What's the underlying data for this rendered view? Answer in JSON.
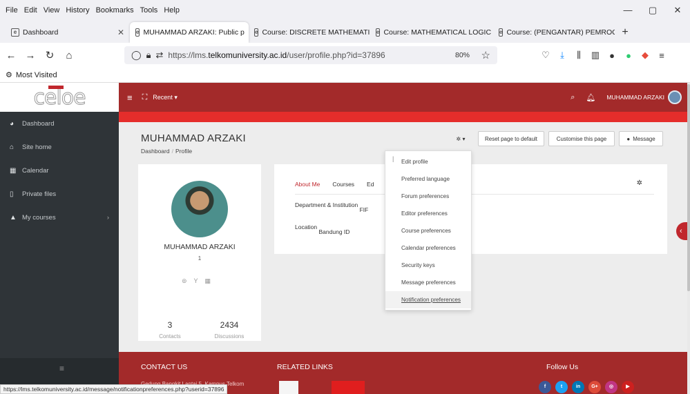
{
  "browser": {
    "menu": [
      "File",
      "Edit",
      "View",
      "History",
      "Bookmarks",
      "Tools",
      "Help"
    ],
    "window_controls": [
      "—",
      "▢",
      "✕"
    ],
    "tabs": [
      {
        "label": "Dashboard",
        "close": "✕"
      },
      {
        "label": "MUHAMMAD ARZAKI: Public p",
        "close": "✕"
      },
      {
        "label": "Course: DISCRETE MATHEMATI",
        "close": "✕"
      },
      {
        "label": "Course: MATHEMATICAL LOGIC",
        "close": "✕"
      },
      {
        "label": "Course: (PENGANTAR) PEMROC",
        "close": "✕"
      }
    ],
    "new_tab": "+",
    "url_prefix": "https://lms.",
    "url_host": "telkomuniversity.ac.id",
    "url_path": "/user/profile.php?id=37896",
    "zoom": "80%",
    "bookmarks_item": "Most Visited",
    "status_url": "https://lms.telkomuniversity.ac.id/message/notificationpreferences.php?userid=37896"
  },
  "site": {
    "logo": "celoe",
    "sidebar_items": [
      {
        "label": "Dashboard",
        "icon": "dashboard-icon"
      },
      {
        "label": "Site home",
        "icon": "home-icon"
      },
      {
        "label": "Calendar",
        "icon": "calendar-icon"
      },
      {
        "label": "Private files",
        "icon": "file-icon"
      },
      {
        "label": "My courses",
        "icon": "graduation-cap-icon"
      }
    ],
    "topbar": {
      "recent": "Recent ▾",
      "user_name": "MUHAMMAD ARZAKI"
    },
    "header": {
      "name": "MUHAMMAD ARZAKI",
      "breadcrumb": [
        "Dashboard",
        "Profile"
      ],
      "buttons": {
        "reset": "Reset page to default",
        "customise": "Customise this page",
        "message": "Message"
      }
    },
    "profile_card": {
      "name": "MUHAMMAD ARZAKI",
      "one": "1",
      "contacts": {
        "value": "3",
        "label": "Contacts"
      },
      "discussions": {
        "value": "2434",
        "label": "Discussions"
      }
    },
    "about": {
      "tabs": [
        "About Me",
        "Courses",
        "Ed"
      ],
      "department_label": "Department & Institution",
      "department_value": "FIF",
      "location_label": "Location",
      "location_value": "Bandung ID"
    },
    "dropdown": [
      "Edit profile",
      "Preferred language",
      "Forum preferences",
      "Editor preferences",
      "Course preferences",
      "Calendar preferences",
      "Security keys",
      "Message preferences",
      "Notification preferences"
    ],
    "footer": {
      "contact": "CONTACT US",
      "related": "RELATED LINKS",
      "follow": "Follow Us",
      "address": "Gedung Bangkit Lantai 5, Kampus Telkom",
      "social": [
        {
          "label": "f",
          "color": "#3b5998"
        },
        {
          "label": "t",
          "color": "#1da1f2"
        },
        {
          "label": "in",
          "color": "#0077b5"
        },
        {
          "label": "G+",
          "color": "#dd4b39"
        },
        {
          "label": "◎",
          "color": "#c13584"
        },
        {
          "label": "▶",
          "color": "#cd201f"
        }
      ]
    }
  }
}
